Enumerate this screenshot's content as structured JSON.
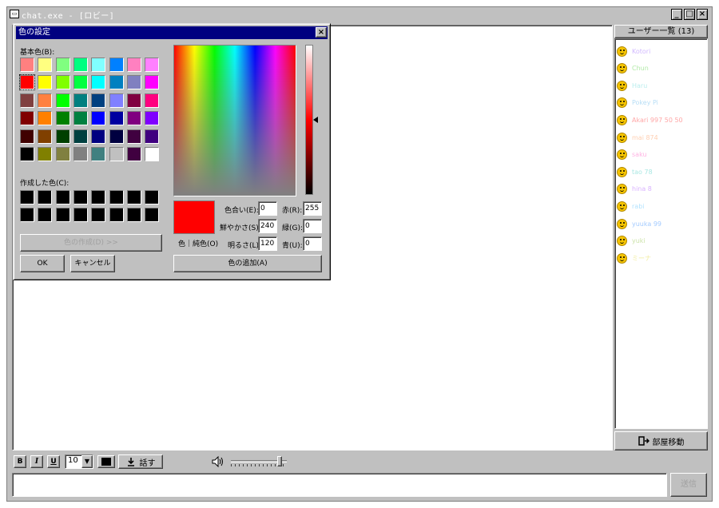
{
  "window": {
    "title": "chat.exe - [ロビー]",
    "min_icon": "_",
    "max_icon": "□",
    "close_icon": "×"
  },
  "users": {
    "header": "ユーザー一覧 (13)",
    "items": [
      {
        "name": "Kotori",
        "color": "#b48cff"
      },
      {
        "name": "Chun",
        "color": "#7ddc6a"
      },
      {
        "name": "Haru",
        "color": "#8fe3e3"
      },
      {
        "name": "Pokey Pi",
        "color": "#88c8f0"
      },
      {
        "name": "Akari 997 50 50",
        "color": "#ff6a6a"
      },
      {
        "name": "mai 874",
        "color": "#ffb080"
      },
      {
        "name": "saku",
        "color": "#ff80d0"
      },
      {
        "name": "tao 78",
        "color": "#70d8d0"
      },
      {
        "name": "hina 8",
        "color": "#c080ff"
      },
      {
        "name": "rabi",
        "color": "#7ed0ff"
      },
      {
        "name": "yuuka 99",
        "color": "#66a8ff"
      },
      {
        "name": "yuki",
        "color": "#aad070"
      },
      {
        "name": "ミーナ",
        "color": "#e8e060"
      }
    ]
  },
  "room_move": {
    "label": "部屋移動",
    "icon": "exit-icon"
  },
  "toolbar": {
    "bold": "B",
    "italic": "I",
    "underline": "U",
    "font_size": "10",
    "color": "#000000",
    "speak_label": "話す",
    "volume": 0.9
  },
  "send_label": "送信",
  "color_dialog": {
    "title": "色の設定",
    "close": "×",
    "basic_label": "基本色(B):",
    "custom_label": "作成した色(C):",
    "define_btn": "色の作成(D) >>",
    "ok": "OK",
    "cancel": "キャンセル",
    "solid_label": "色｜純色(O)",
    "add_btn": "色の追加(A)",
    "hue_label": "色合い(E):",
    "hue": "0",
    "sat_label": "鮮やかさ(S):",
    "sat": "240",
    "lum_label": "明るさ(L):",
    "lum": "120",
    "red_label": "赤(R):",
    "red": "255",
    "green_label": "緑(G):",
    "green": "0",
    "blue_label": "青(U):",
    "blue": "0",
    "current_color": "#ff0000",
    "basic_colors": [
      "#ff8080",
      "#ffff80",
      "#80ff80",
      "#00ff80",
      "#80ffff",
      "#0080ff",
      "#ff80c0",
      "#ff80ff",
      "#ff0000",
      "#ffff00",
      "#80ff00",
      "#00ff40",
      "#00ffff",
      "#0080c0",
      "#8080c0",
      "#ff00ff",
      "#804040",
      "#ff8040",
      "#00ff00",
      "#008080",
      "#004080",
      "#8080ff",
      "#800040",
      "#ff0080",
      "#800000",
      "#ff8000",
      "#008000",
      "#008040",
      "#0000ff",
      "#0000a0",
      "#800080",
      "#8000ff",
      "#400000",
      "#804000",
      "#004000",
      "#004040",
      "#000080",
      "#000040",
      "#400040",
      "#400080",
      "#000000",
      "#808000",
      "#808040",
      "#808080",
      "#408080",
      "#c0c0c0",
      "#400040",
      "#ffffff"
    ],
    "selected_index": 8,
    "custom_colors": [
      "#000000",
      "#000000",
      "#000000",
      "#000000",
      "#000000",
      "#000000",
      "#000000",
      "#000000",
      "#000000",
      "#000000",
      "#000000",
      "#000000",
      "#000000",
      "#000000",
      "#000000",
      "#000000"
    ]
  }
}
